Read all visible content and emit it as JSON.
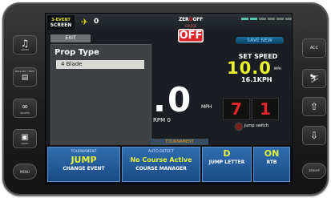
{
  "top_bar": {
    "event_screen_line1": "3-EVENT",
    "event_screen_line2": "SCREEN",
    "plane_count": "0",
    "brand_left": "ZER",
    "brand_mid": "O",
    "brand_right": "OFF",
    "cruise_label": "CRUISE",
    "off_sign": "OFF"
  },
  "left_panel": {
    "exit_label": "EXIT",
    "prop_type_title": "Prop Type",
    "prop_type_value": "4 Blade"
  },
  "speed": {
    "save_new_label": "SAVE NEW",
    "set_speed_label": "SET SPEED",
    "set_speed_value": "10.0",
    "set_speed_unit": "MPH",
    "set_speed_kph": "16.1KPH",
    "current_speed": ".0",
    "current_speed_unit": "MPH",
    "rpm_label": "RPM 0",
    "tournament_tab": "TOURNAMENT"
  },
  "jump": {
    "left_digit": "7",
    "right_digit": "1",
    "switch_label": "jump switch"
  },
  "bottom_bar": [
    {
      "top": "TOURNAMENT",
      "value": "JUMP",
      "label": "CHANGE EVENT"
    },
    {
      "top": "AUTO DETECT",
      "value": "No Course Active",
      "label": "COURSE MANAGER"
    },
    {
      "top": "",
      "value": "D",
      "label": "JUMP LETTER"
    },
    {
      "top": "",
      "value": "ON",
      "label": "RTB"
    }
  ],
  "left_buttons": [
    {
      "label": "AUDIO",
      "icon": "music-icon"
    },
    {
      "label": "BALLAST / TRIM",
      "icon": "ballast-icon"
    },
    {
      "label": "SHAPES",
      "icon": "shapes-icon"
    },
    {
      "label": "VIDEO",
      "icon": "video-icon"
    }
  ],
  "right_buttons": [
    {
      "label": "ACC",
      "icon": "acc"
    },
    {
      "label": "",
      "icon": "skier-icon"
    },
    {
      "label": "",
      "icon": "arrow-up-icon"
    },
    {
      "label": "",
      "icon": "arrow-down-icon"
    }
  ],
  "menu_button_label": "MENU",
  "zero_off_button_label": "ZEROFF",
  "colors": {
    "accent_yellow": "#e6f22b",
    "accent_red": "#e3262b",
    "button_blue": "#2e6db0"
  }
}
